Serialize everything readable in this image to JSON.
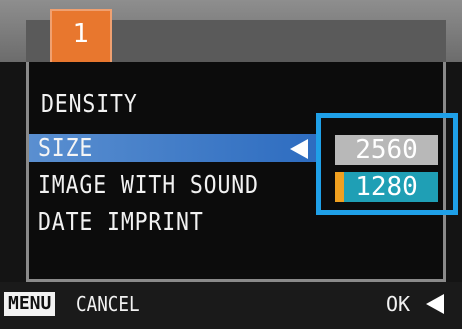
{
  "tabs": [
    {
      "label": "1",
      "active": true
    }
  ],
  "menu": {
    "items": [
      {
        "label": "DENSITY"
      },
      {
        "label": "SIZE",
        "selected": true
      },
      {
        "label": "IMAGE WITH SOUND"
      },
      {
        "label": "DATE IMPRINT"
      }
    ]
  },
  "size_options": {
    "options": [
      "2560",
      "1280"
    ],
    "highlighted": "2560",
    "current": "1280"
  },
  "footer": {
    "menu_key": "MENU",
    "cancel_label": "CANCEL",
    "ok_label": "OK"
  },
  "colors": {
    "tab_accent": "#e8772e",
    "selection_bar": "#2d6cc0",
    "options_frame": "#1fa0e8",
    "current_option": "#1f9fb5",
    "current_marker": "#f0a020"
  },
  "icons": {
    "selection_arrow": "left-triangle-icon",
    "ok_arrow": "left-triangle-icon"
  }
}
